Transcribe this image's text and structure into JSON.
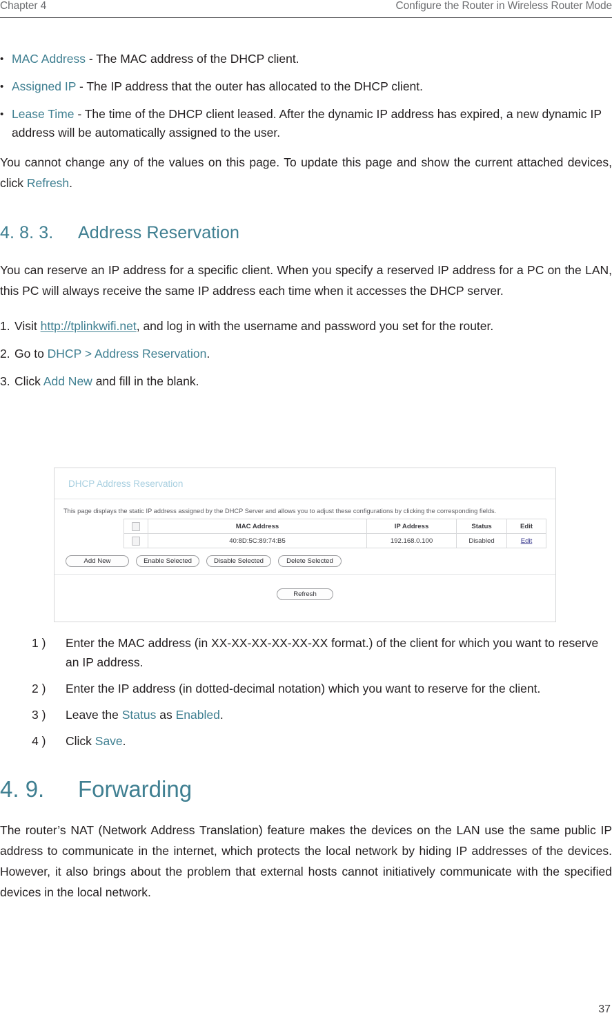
{
  "header": {
    "chapter": "Chapter 4",
    "title": "Configure the Router in Wireless Router Mode"
  },
  "bullets": [
    {
      "mark": "•",
      "term": "MAC Address",
      "rest": " - The MAC address of the DHCP client."
    },
    {
      "mark": "•",
      "term": "Assigned IP",
      "rest": " - The IP address that the outer has allocated to the DHCP client."
    },
    {
      "mark": "•",
      "term": "Lease Time",
      "rest": " - The time of the DHCP client leased. After the dynamic IP address has expired, a new dynamic IP address will be automatically assigned to the user."
    }
  ],
  "intro_paragraph": {
    "part1": "You cannot change any of the values on this page. To update this page and show the current attached devices, click ",
    "link": "Refresh",
    "part2": "."
  },
  "section_address_reservation": {
    "number": "4. 8. 3.",
    "title": "Address Reservation",
    "body": "You can reserve an IP address for a specific client. When you specify a reserved IP address for a PC on the LAN, this PC will always receive the same IP address each time when it accesses the DHCP server.",
    "steps": [
      {
        "marker": "1.",
        "part1": "Visit ",
        "link": "http://tplinkwifi.net",
        "part2": ", and log in with the username and password you set for the router."
      },
      {
        "marker": "2.",
        "part1": "Go to ",
        "link": "DHCP",
        "part2": " > ",
        "link2": "Address Reservation",
        "part3": "."
      },
      {
        "marker": "3.",
        "part1": "Click ",
        "link": "Add New",
        "part2": " and fill in the blank."
      }
    ],
    "substeps": [
      {
        "marker": "1 )",
        "text": "Enter the MAC address (in XX-XX-XX-XX-XX-XX format.) of the client for which you want to reserve an IP address."
      },
      {
        "marker": "2 )",
        "text": "Enter the IP address (in dotted-decimal notation) which you want to reserve for the client."
      },
      {
        "marker": "3 )",
        "prefix": "Leave the ",
        "link": "Status",
        "middle": " as ",
        "link2": "Enabled",
        "suffix": "."
      },
      {
        "marker": "4 )",
        "prefix": "Click ",
        "link": "Save",
        "suffix": "."
      }
    ]
  },
  "router_ui": {
    "panel_title": "DHCP Address Reservation",
    "description": "This page displays the static IP address assigned by the DHCP Server and allows you to adjust these configurations by clicking the corresponding fields.",
    "table": {
      "columns": [
        "",
        "MAC Address",
        "IP Address",
        "Status",
        "Edit"
      ],
      "rows": [
        {
          "checkbox": "",
          "mac": "40:8D:5C:89:74:B5",
          "ip": "192.168.0.100",
          "status": "Disabled",
          "edit": "Edit"
        }
      ]
    },
    "buttons": [
      "Add New",
      "Enable Selected",
      "Disable Selected",
      "Delete Selected"
    ],
    "refresh_button": "Refresh"
  },
  "section_forwarding": {
    "number": "4. 9.",
    "title": "Forwarding",
    "body": "The router’s NAT (Network Address Translation) feature makes the devices on the LAN use the same public IP address to communicate in the internet, which protects the local network by hiding IP addresses of the devices. However, it also brings about the problem that external hosts cannot initiatively communicate with the specified devices in the local network."
  },
  "footer": {
    "page_number": "37"
  },
  "colors": {
    "accent_teal": "#3f7f91",
    "panel_title_blue": "#a8cfe0",
    "header_gray": "#6d6e71",
    "edit_link_blue": "#3b3b8f"
  }
}
